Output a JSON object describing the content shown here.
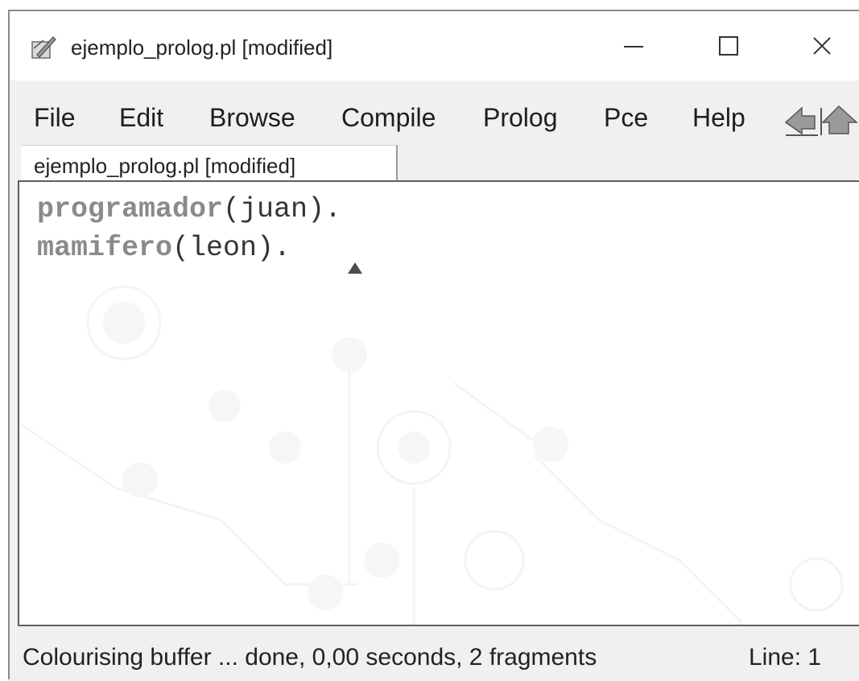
{
  "window": {
    "title": "ejemplo_prolog.pl [modified]",
    "minimize_glyph": "—",
    "close_glyph": "✕"
  },
  "menu": {
    "items": [
      "File",
      "Edit",
      "Browse",
      "Compile",
      "Prolog",
      "Pce",
      "Help"
    ]
  },
  "tabs": [
    {
      "label": "ejemplo_prolog.pl [modified]"
    }
  ],
  "editor": {
    "lines": [
      {
        "predicate": "programador",
        "rest": "(juan)."
      },
      {
        "predicate": "mamifero",
        "rest": "(leon)."
      }
    ]
  },
  "status": {
    "message": "Colourising buffer ... done, 0,00 seconds, 2 fragments",
    "line": "Line: 1"
  },
  "icons": {
    "app": "edit-feather-icon",
    "nav_back": "arrow-left-icon",
    "nav_forward": "arrow-up-icon"
  },
  "colors": {
    "predicate": "#8a8a8a",
    "text": "#353535",
    "chrome": "#f0f0f0"
  }
}
